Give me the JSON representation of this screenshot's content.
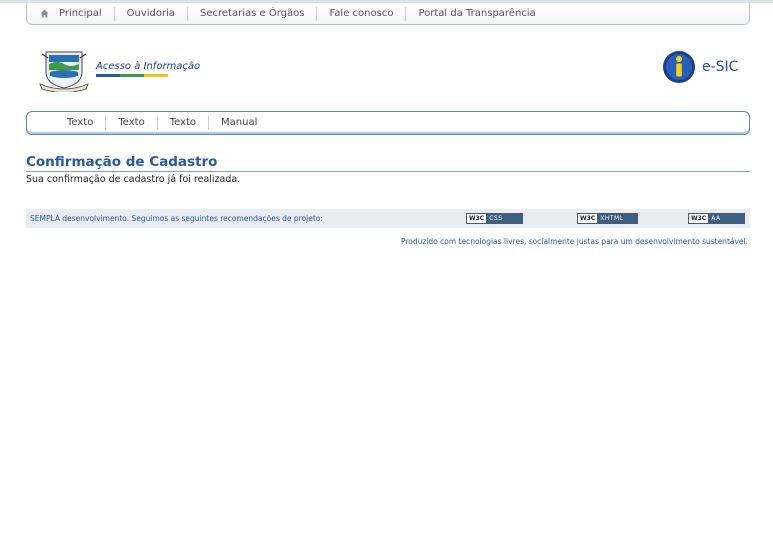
{
  "top_nav": {
    "items": [
      "Principal",
      "Ouvidoria",
      "Secretarias e Órgãos",
      "Fale conosco",
      "Portal da Transparência"
    ]
  },
  "header": {
    "logo_text": "Acesso à Informação",
    "esic_label": "e-SIC"
  },
  "sub_nav": {
    "items": [
      "Texto",
      "Texto",
      "Texto",
      "Manual"
    ]
  },
  "main": {
    "title": "Confirmação de Cadastro",
    "message": "Sua confirmação de cadastro já foi realizada."
  },
  "footer": {
    "text": "SEMPLA desenvolvimento. Seguimos as seguintes recomendações de projeto:",
    "badges": [
      {
        "w3": "W3C",
        "label": "CSS"
      },
      {
        "w3": "W3C",
        "label": "XHTML"
      },
      {
        "w3": "W3C",
        "label": "AA"
      }
    ],
    "produced": "Produzido com tecnologias livres, socialmente justas para um desenvolvimento sustentável."
  },
  "colors": {
    "link_blue": "#2a57a2",
    "nav_border": "#5b86c3",
    "footer_bg": "#e9ecf0"
  }
}
